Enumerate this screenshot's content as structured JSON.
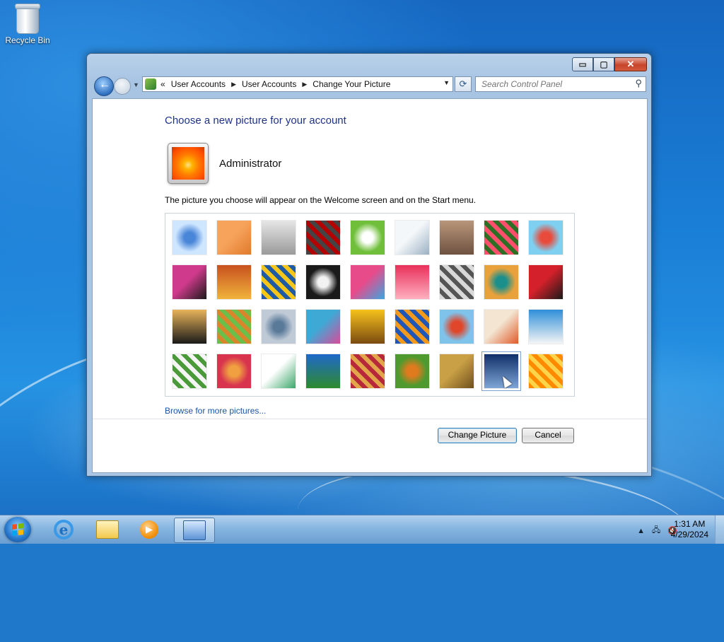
{
  "desktop": {
    "icons": [
      {
        "label": "Recycle Bin",
        "icon": "recycle-bin-icon"
      }
    ]
  },
  "window": {
    "caption_buttons": {
      "minimize": "▭",
      "maximize": "▢",
      "close": "✕"
    },
    "breadcrumb": {
      "overflow": "«",
      "items": [
        "User Accounts",
        "User Accounts",
        "Change Your Picture"
      ]
    },
    "search": {
      "placeholder": "Search Control Panel"
    },
    "heading": "Choose a new picture for your account",
    "account": {
      "name": "Administrator"
    },
    "info_text": "The picture you choose will appear on the Welcome screen and on the Start menu.",
    "pictures": [
      {
        "name": "roller-coaster",
        "colors": [
          "#cfe6ff",
          "#4a86d8"
        ],
        "selected": false
      },
      {
        "name": "starfish",
        "colors": [
          "#f7a35c",
          "#e07a2c"
        ],
        "selected": false
      },
      {
        "name": "robot",
        "colors": [
          "#e6e6e6",
          "#9a9a9a"
        ],
        "selected": false
      },
      {
        "name": "record-player",
        "colors": [
          "#444444",
          "#b30000"
        ],
        "selected": false
      },
      {
        "name": "lucky-cat",
        "colors": [
          "#6fbf3a",
          "#ffffff"
        ],
        "selected": false
      },
      {
        "name": "gyroscope",
        "colors": [
          "#f4f7fa",
          "#9bb0c2"
        ],
        "selected": false
      },
      {
        "name": "kitten",
        "colors": [
          "#b8967a",
          "#6e5240"
        ],
        "selected": false
      },
      {
        "name": "flower",
        "colors": [
          "#ff4f6d",
          "#2f6e25"
        ],
        "selected": false
      },
      {
        "name": "pinwheel",
        "colors": [
          "#7fd0f0",
          "#e84b3c"
        ],
        "selected": false
      },
      {
        "name": "ball",
        "colors": [
          "#d03a8c",
          "#1a1a1a"
        ],
        "selected": false
      },
      {
        "name": "fabric",
        "colors": [
          "#c8501e",
          "#f0b43c"
        ],
        "selected": false
      },
      {
        "name": "leaf",
        "colors": [
          "#1f5aa6",
          "#f5c518"
        ],
        "selected": false
      },
      {
        "name": "dog",
        "colors": [
          "#1a1a1a",
          "#f2f2f2"
        ],
        "selected": false
      },
      {
        "name": "crayons",
        "colors": [
          "#e84b8a",
          "#3aa7e0"
        ],
        "selected": false
      },
      {
        "name": "star-lantern",
        "colors": [
          "#e8305a",
          "#ffb0c0"
        ],
        "selected": false
      },
      {
        "name": "jacks",
        "colors": [
          "#d9d9d9",
          "#555555"
        ],
        "selected": false
      },
      {
        "name": "stairs",
        "colors": [
          "#e9a23b",
          "#1a8f8c"
        ],
        "selected": false
      },
      {
        "name": "paper-crane",
        "colors": [
          "#d4202a",
          "#1a1a1a"
        ],
        "selected": false
      },
      {
        "name": "guitar",
        "colors": [
          "#e8b35a",
          "#1a1a1a"
        ],
        "selected": false
      },
      {
        "name": "puppy",
        "colors": [
          "#6abf4b",
          "#d9852c"
        ],
        "selected": false
      },
      {
        "name": "toy-robot",
        "colors": [
          "#bfcad6",
          "#5a7a9a"
        ],
        "selected": false
      },
      {
        "name": "scarves",
        "colors": [
          "#3fa9d6",
          "#d84b9a"
        ],
        "selected": false
      },
      {
        "name": "sunflower",
        "colors": [
          "#f6c21c",
          "#7a4a10"
        ],
        "selected": false
      },
      {
        "name": "fish",
        "colors": [
          "#1f56b8",
          "#f39a1d"
        ],
        "selected": false
      },
      {
        "name": "balloon",
        "colors": [
          "#7fc2ea",
          "#e0462a"
        ],
        "selected": false
      },
      {
        "name": "doll",
        "colors": [
          "#f3e5d1",
          "#e05a2a"
        ],
        "selected": false
      },
      {
        "name": "sailboat",
        "colors": [
          "#2f8fd8",
          "#f5f5f5"
        ],
        "selected": false
      },
      {
        "name": "soccer-ball",
        "colors": [
          "#f5f5f5",
          "#4b9a3a"
        ],
        "selected": false
      },
      {
        "name": "textile",
        "colors": [
          "#d8344e",
          "#f0a040"
        ],
        "selected": false
      },
      {
        "name": "marbles",
        "colors": [
          "#ffffff",
          "#3aa76a"
        ],
        "selected": false
      },
      {
        "name": "window-frame",
        "colors": [
          "#1f68c8",
          "#2e8b2e"
        ],
        "selected": false
      },
      {
        "name": "pattern",
        "colors": [
          "#b6283a",
          "#e2a54a"
        ],
        "selected": false
      },
      {
        "name": "butterfly",
        "colors": [
          "#4f9a2e",
          "#e07a1e"
        ],
        "selected": false
      },
      {
        "name": "weave",
        "colors": [
          "#c9a045",
          "#6e4f1c"
        ],
        "selected": false
      },
      {
        "name": "lighthouse",
        "colors": [
          "#0f2f68",
          "#7fa6d6"
        ],
        "selected": true
      },
      {
        "name": "orange-flower",
        "colors": [
          "#ff8a00",
          "#ffd34a"
        ],
        "selected": false
      }
    ],
    "browse_link": "Browse for more pictures...",
    "buttons": {
      "change": "Change Picture",
      "cancel": "Cancel"
    }
  },
  "taskbar": {
    "items": [
      "start-button",
      "internet-explorer",
      "windows-explorer",
      "media-player",
      "control-panel"
    ],
    "active": "control-panel",
    "tray": {
      "show_hidden": "▲"
    },
    "clock": {
      "time": "1:31 AM",
      "date": "4/29/2024"
    }
  }
}
